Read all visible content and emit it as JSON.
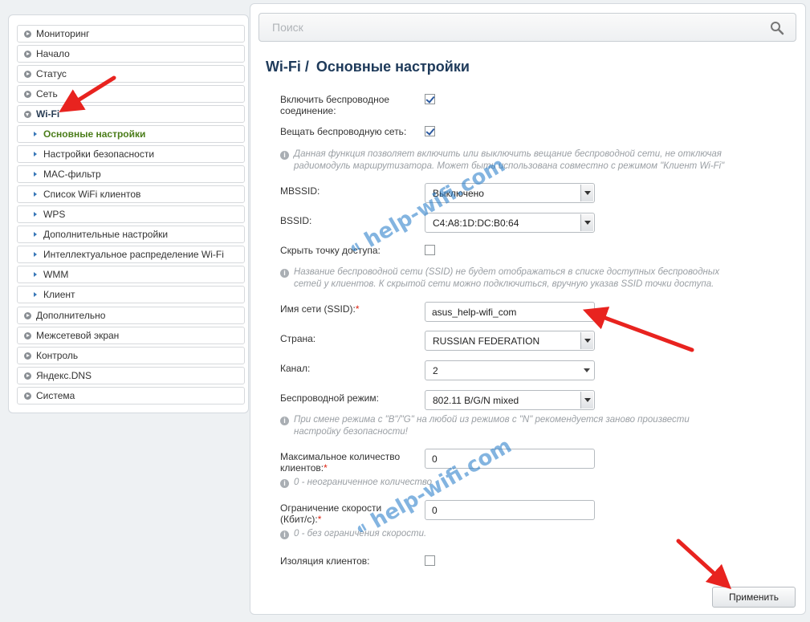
{
  "sidebar": {
    "items": [
      {
        "label": "Мониторинг"
      },
      {
        "label": "Начало"
      },
      {
        "label": "Статус"
      },
      {
        "label": "Сеть"
      },
      {
        "label": "Wi-Fi"
      },
      {
        "label": "Основные настройки"
      },
      {
        "label": "Настройки безопасности"
      },
      {
        "label": "MAC-фильтр"
      },
      {
        "label": "Список WiFi клиентов"
      },
      {
        "label": "WPS"
      },
      {
        "label": "Дополнительные настройки"
      },
      {
        "label": "Интеллектуальное распределение Wi-Fi"
      },
      {
        "label": "WMM"
      },
      {
        "label": "Клиент"
      },
      {
        "label": "Дополнительно"
      },
      {
        "label": "Межсетевой экран"
      },
      {
        "label": "Контроль"
      },
      {
        "label": "Яндекс.DNS"
      },
      {
        "label": "Система"
      }
    ]
  },
  "search": {
    "placeholder": "Поиск"
  },
  "page": {
    "title_section": "Wi-Fi",
    "title_sep": "/",
    "title_page": "Основные настройки"
  },
  "form": {
    "enable_wireless": {
      "label_line1": "Включить беспроводное",
      "label_line2": "соединение:",
      "checked": true
    },
    "broadcast": {
      "label": "Вещать беспроводную сеть:",
      "checked": true,
      "hint_line1": "Данная функция позволяет включить или выключить вещание беспроводной сети, не отключая",
      "hint_line2": "радиомодуль маршрутизатора. Может быть использована совместно с режимом \"Клиент Wi-Fi\""
    },
    "mbssid": {
      "label": "MBSSID:",
      "value": "Выключено"
    },
    "bssid": {
      "label": "BSSID:",
      "value": "C4:A8:1D:DC:B0:64"
    },
    "hide_ap": {
      "label": "Скрыть точку доступа:",
      "checked": false,
      "hint_line1": "Название беспроводной сети (SSID) не будет отображаться в списке доступных беспроводных",
      "hint_line2": "сетей у клиентов. К скрытой сети можно подключиться, вручную указав SSID точки доступа."
    },
    "ssid": {
      "label": "Имя сети (SSID):",
      "required": "*",
      "value": "asus_help-wifi_com"
    },
    "country": {
      "label": "Страна:",
      "value": "RUSSIAN FEDERATION"
    },
    "channel": {
      "label": "Канал:",
      "value": "2"
    },
    "wireless_mode": {
      "label": "Беспроводной режим:",
      "value": "802.11 B/G/N mixed",
      "hint_line1": "При смене режима с \"B\"/\"G\" на любой из режимов с \"N\" рекомендуется заново произвести",
      "hint_line2": "настройку безопасности!"
    },
    "max_clients": {
      "label_line1": "Максимальное количество",
      "label_line2": "клиентов:",
      "required": "*",
      "value": "0",
      "hint": "0 - неограниченное количество"
    },
    "speed_limit": {
      "label_line1": "Ограничение скорости",
      "label_line2": "(Кбит/с):",
      "required": "*",
      "value": "0",
      "hint": "0 - без ограничения скорости."
    },
    "isolation": {
      "label": "Изоляция клиентов:",
      "checked": false
    }
  },
  "buttons": {
    "apply": "Применить"
  },
  "watermarks": [
    "help-wifi.com",
    "help-wifi.com"
  ],
  "colors": {
    "annotation_arrow": "#e8231f",
    "title": "#1e3a5a",
    "active_menu": "#4b7d1a"
  }
}
